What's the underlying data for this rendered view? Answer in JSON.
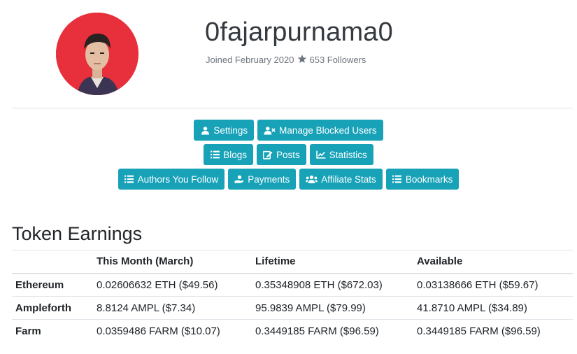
{
  "profile": {
    "username": "0fajarpurnama0",
    "joined": "Joined February 2020",
    "followers": "653 Followers",
    "avatar_icon": "profile-photo",
    "avatar_bg": "#e8303c"
  },
  "accent_color": "#17a2b8",
  "buttons": {
    "row1": [
      {
        "label": "Settings",
        "icon": "user-icon"
      },
      {
        "label": "Manage Blocked Users",
        "icon": "user-block-icon"
      }
    ],
    "row2": [
      {
        "label": "Blogs",
        "icon": "list-icon"
      },
      {
        "label": "Posts",
        "icon": "edit-icon"
      },
      {
        "label": "Statistics",
        "icon": "chart-line-icon"
      }
    ],
    "row3": [
      {
        "label": "Authors You Follow",
        "icon": "list-icon"
      },
      {
        "label": "Payments",
        "icon": "hand-coin-icon"
      },
      {
        "label": "Affiliate Stats",
        "icon": "users-icon"
      },
      {
        "label": "Bookmarks",
        "icon": "list-icon"
      }
    ]
  },
  "earnings": {
    "title": "Token Earnings",
    "headers": [
      "",
      "This Month (March)",
      "Lifetime",
      "Available"
    ],
    "rows": [
      {
        "token": "Ethereum",
        "month": "0.02606632 ETH ($49.56)",
        "lifetime": "0.35348908 ETH ($672.03)",
        "available": "0.03138666 ETH ($59.67)"
      },
      {
        "token": "Ampleforth",
        "month": "8.8124 AMPL ($7.34)",
        "lifetime": "95.9839 AMPL ($79.99)",
        "available": "41.8710 AMPL ($34.89)"
      },
      {
        "token": "Farm",
        "month": "0.0359486 FARM ($10.07)",
        "lifetime": "0.3449185 FARM ($96.59)",
        "available": "0.3449185 FARM ($96.59)"
      }
    ]
  }
}
